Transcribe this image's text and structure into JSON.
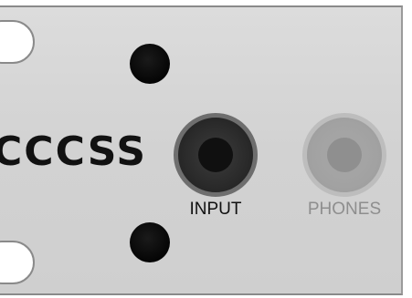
{
  "panel": {
    "brand_text": "CCCSS",
    "jacks": [
      {
        "label": "INPUT"
      },
      {
        "label": "PHONES"
      }
    ]
  }
}
